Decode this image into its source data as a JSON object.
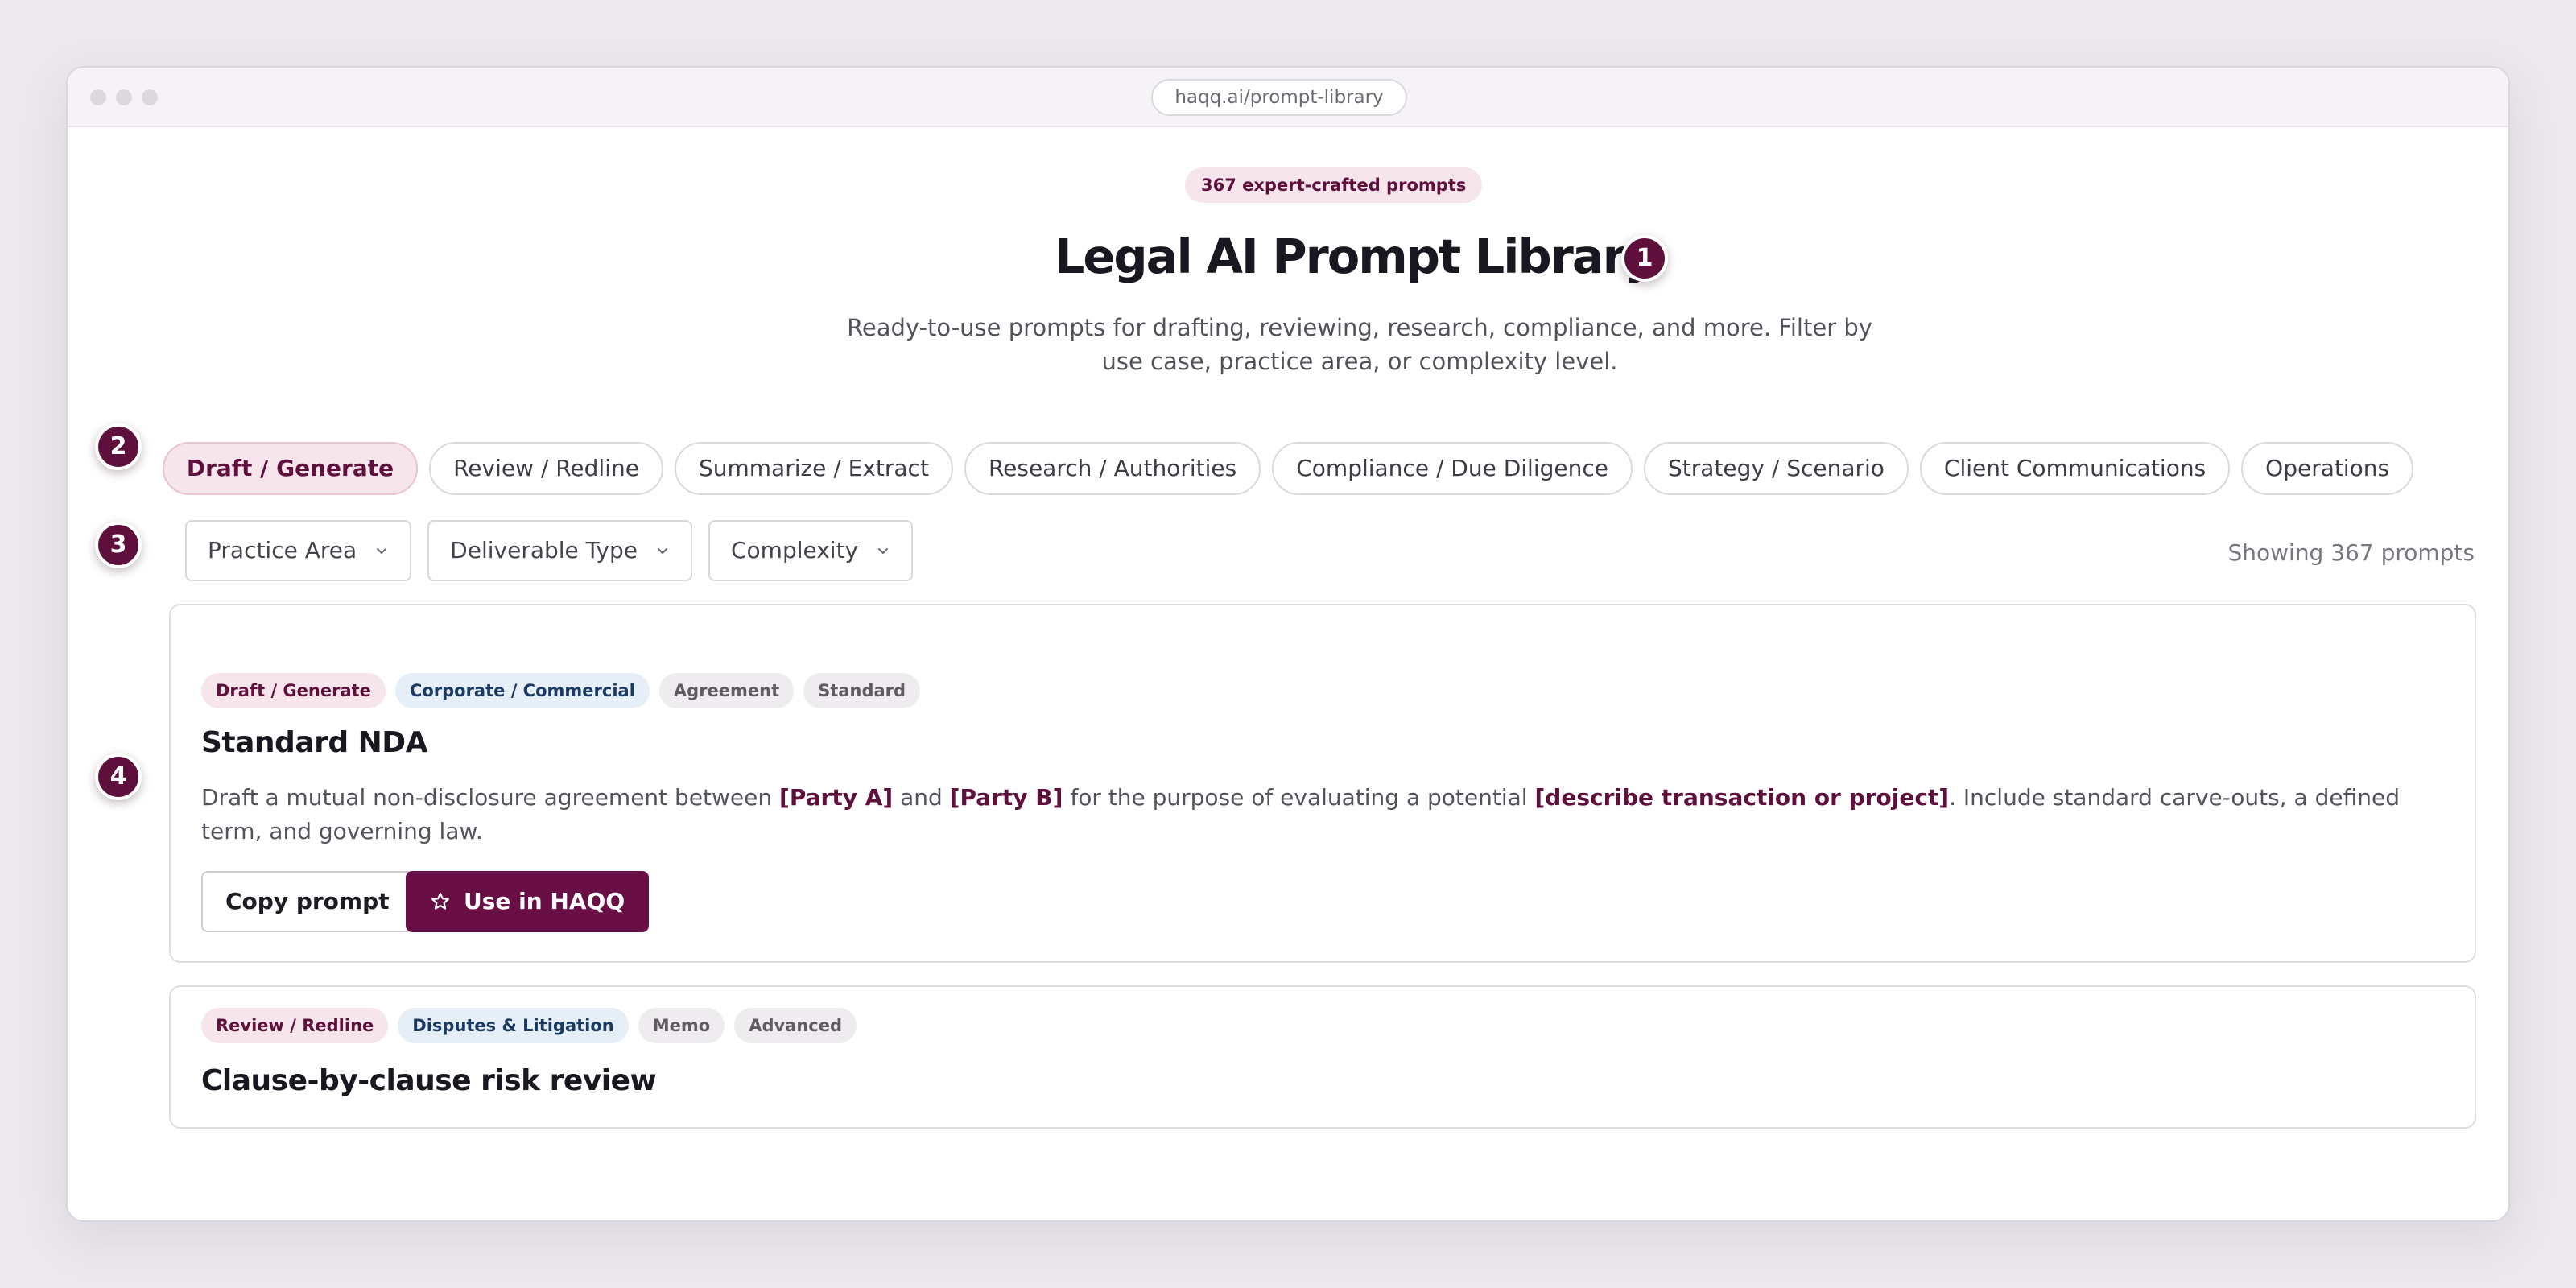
{
  "browser": {
    "url": "haqq.ai/prompt-library"
  },
  "header": {
    "badge": "367 expert-crafted prompts",
    "title": "Legal AI Prompt Library",
    "subtitle": "Ready-to-use prompts for drafting, reviewing, research, compliance, and more. Filter by use case, practice area, or complexity level."
  },
  "markers": [
    "1",
    "2",
    "3",
    "4"
  ],
  "categories": [
    "Draft / Generate",
    "Review / Redline",
    "Summarize / Extract",
    "Research / Authorities",
    "Compliance / Due Diligence",
    "Strategy / Scenario",
    "Client Communications",
    "Operations"
  ],
  "active_category": "Draft / Generate",
  "filters": {
    "practice_area": "Practice Area",
    "deliverable_type": "Deliverable Type",
    "complexity": "Complexity",
    "showing": "Showing 367 prompts"
  },
  "cards": [
    {
      "tags": [
        "Draft / Generate",
        "Corporate / Commercial",
        "Agreement",
        "Standard"
      ],
      "title": "Standard NDA",
      "desc": {
        "t1": "Draft a mutual non-disclosure agreement between ",
        "p1": "[Party A]",
        "t2": " and ",
        "p2": "[Party B]",
        "t3": " for the purpose of evaluating a potential ",
        "p3": "[describe transaction or project]",
        "t4": ". Include standard carve-outs, a defined term, and governing law."
      },
      "copy_label": "Copy prompt",
      "use_label": "Use in HAQQ",
      "use_icon": "star-icon"
    },
    {
      "tags": [
        "Review / Redline",
        "Disputes & Litigation",
        "Memo",
        "Advanced"
      ],
      "title": "Clause-by-clause risk review"
    }
  ],
  "colors": {
    "accent": "#5E0F3C",
    "accent_soft": "#F6E6EC",
    "area_tag": "#E6EEF8",
    "background": "#ECE9EE"
  }
}
